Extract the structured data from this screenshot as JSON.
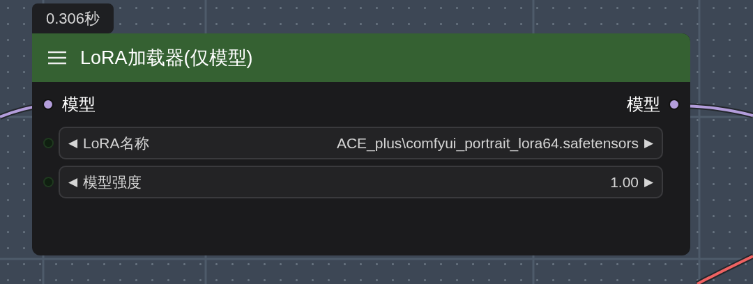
{
  "timing": "0.306秒",
  "node": {
    "title": "LoRA加载器(仅模型)",
    "inputs": [
      {
        "label": "模型",
        "color": "#b39ddb"
      }
    ],
    "outputs": [
      {
        "label": "模型",
        "color": "#b39ddb"
      }
    ],
    "widgets": [
      {
        "label": "LoRA名称",
        "value": "ACE_plus\\comfyui_portrait_lora64.safetensors",
        "decrement": "◀",
        "increment": "▶"
      },
      {
        "label": "模型强度",
        "value": "1.00",
        "decrement": "◀",
        "increment": "▶"
      }
    ]
  }
}
